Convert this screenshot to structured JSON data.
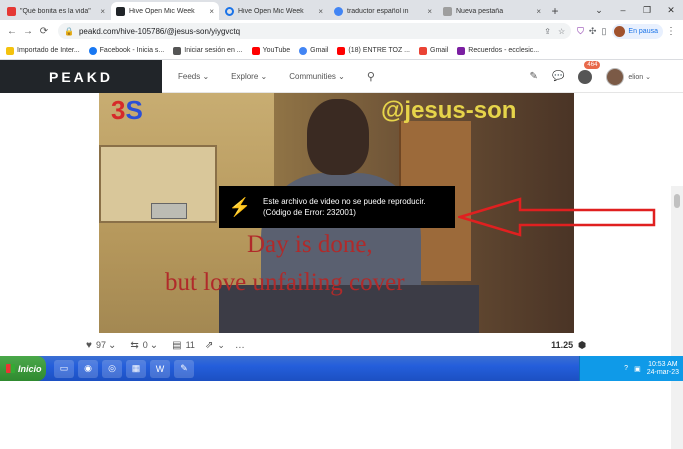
{
  "tabs": [
    {
      "title": "\"Qué bonita es la vida\"",
      "color": "#e53935",
      "active": false
    },
    {
      "title": "Hive Open Mic Week",
      "color": "#212529",
      "active": true
    },
    {
      "title": "Hive Open Mic Week",
      "color": "#1a73e8",
      "active": false
    },
    {
      "title": "traductor español in",
      "color": "#4285f4",
      "active": false
    },
    {
      "title": "Nueva pestaña",
      "color": "#9e9e9e",
      "active": false
    }
  ],
  "browser": {
    "url": "peakd.com/hive-105786/@jesus-son/yiygvctq",
    "profile_label": "En pausa",
    "back": "←",
    "forward": "→",
    "reload": "⟳"
  },
  "bookmarks": [
    {
      "label": "Importado de Inter...",
      "color": "#f4c20d"
    },
    {
      "label": "Facebook - Inicia s...",
      "color": "#1877f2"
    },
    {
      "label": "Iniciar sesión en ...",
      "color": "#555555"
    },
    {
      "label": "YouTube",
      "color": "#ff0000"
    },
    {
      "label": "Gmail",
      "color": "#4285f4"
    },
    {
      "label": "(18) ENTRE TOZ ...",
      "color": "#ff0000"
    },
    {
      "label": "Gmail",
      "color": "#ea4335"
    },
    {
      "label": "Recuerdos - ecclesic...",
      "color": "#7b1fa2"
    }
  ],
  "peakd": {
    "logo": "PEAKD",
    "menu": [
      "Feeds",
      "Explore",
      "Communities"
    ],
    "notif_count": "464",
    "username": "elion"
  },
  "video": {
    "overlay_title": "@jesus-son",
    "overlay_line1": "Day is done,",
    "overlay_line2": "but love unfailing cover",
    "logo_3": "3",
    "logo_s": "S",
    "error_line1": "Este archivo de video no se puede reproducir.",
    "error_line2": "(Código de Error: 232001)"
  },
  "actions": {
    "votes": "97",
    "reblogs": "0",
    "comments": "11",
    "payout": "11.25"
  },
  "taskbar": {
    "start_label": "Inicio",
    "time": "10:53 AM",
    "date": "24-mar-23"
  },
  "colors": {
    "peakd_dark": "#212529",
    "arrow_red": "#e02020",
    "taskbar_blue": "#245edb"
  }
}
